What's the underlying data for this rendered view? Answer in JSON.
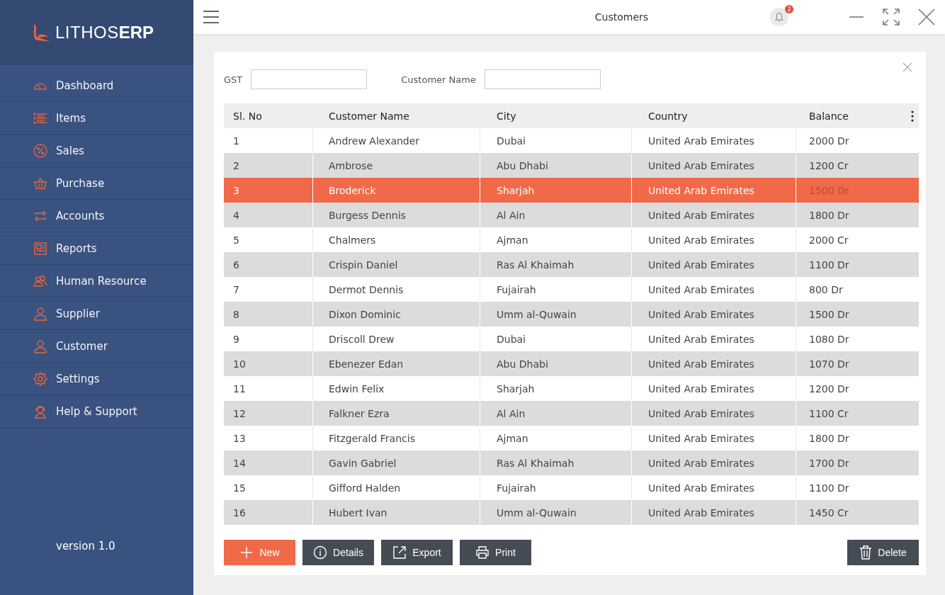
{
  "logo": {
    "light": "LITHOS",
    "bold": "ERP"
  },
  "sidebar": {
    "items": [
      {
        "label": "Dashboard",
        "kind": "gauge"
      },
      {
        "label": "Items",
        "kind": "list"
      },
      {
        "label": "Sales",
        "kind": "percent"
      },
      {
        "label": "Purchase",
        "kind": "basket"
      },
      {
        "label": "Accounts",
        "kind": "swap"
      },
      {
        "label": "Reports",
        "kind": "report"
      },
      {
        "label": "Human Resource",
        "kind": "people"
      },
      {
        "label": "Supplier",
        "kind": "person"
      },
      {
        "label": "Customer",
        "kind": "person"
      },
      {
        "label": "Settings",
        "kind": "gear"
      },
      {
        "label": "Help & Support",
        "kind": "headset"
      }
    ],
    "version": "version 1.0"
  },
  "window": {
    "title": "Customers",
    "notifications": "2"
  },
  "filters": [
    {
      "label": "GST"
    },
    {
      "label": "Customer Name"
    }
  ],
  "table": {
    "columns": [
      "Sl. No",
      "Customer Name",
      "City",
      "Country",
      "Balance"
    ],
    "rows": [
      {
        "cells": [
          "1",
          "Andrew Alexander",
          "Dubai",
          "United Arab Emirates",
          "2000 Dr"
        ],
        "selected": false
      },
      {
        "cells": [
          "2",
          "Ambrose",
          "Abu Dhabi",
          "United Arab Emirates",
          "1200 Cr"
        ],
        "selected": false
      },
      {
        "cells": [
          "3",
          "Broderick",
          "Sharjah",
          "United Arab Emirates",
          "1500 Dr"
        ],
        "selected": true
      },
      {
        "cells": [
          "4",
          "Burgess Dennis",
          "Al Ain",
          "United Arab Emirates",
          "1800 Dr"
        ],
        "selected": false
      },
      {
        "cells": [
          "5",
          "Chalmers",
          "Ajman",
          "United Arab Emirates",
          "2000 Cr"
        ],
        "selected": false
      },
      {
        "cells": [
          "6",
          "Crispin Daniel",
          "Ras Al Khaimah",
          "United Arab Emirates",
          "1100 Dr"
        ],
        "selected": false
      },
      {
        "cells": [
          "7",
          "Dermot Dennis",
          "Fujairah",
          "United Arab Emirates",
          "800 Dr"
        ],
        "selected": false
      },
      {
        "cells": [
          "8",
          "Dixon Dominic",
          "Umm al-Quwain",
          "United Arab Emirates",
          "1500 Dr"
        ],
        "selected": false
      },
      {
        "cells": [
          "9",
          "Driscoll Drew",
          "Dubai",
          "United Arab Emirates",
          "1080 Dr"
        ],
        "selected": false
      },
      {
        "cells": [
          "10",
          "Ebenezer Edan",
          "Abu Dhabi",
          "United Arab Emirates",
          "1070 Dr"
        ],
        "selected": false
      },
      {
        "cells": [
          "11",
          "Edwin Felix",
          "Sharjah",
          "United Arab Emirates",
          "1200 Dr"
        ],
        "selected": false
      },
      {
        "cells": [
          "12",
          "Falkner Ezra",
          "Al Ain",
          "United Arab Emirates",
          "1100 Cr"
        ],
        "selected": false
      },
      {
        "cells": [
          "13",
          "Fitzgerald Francis",
          "Ajman",
          "United Arab Emirates",
          "1800 Dr"
        ],
        "selected": false
      },
      {
        "cells": [
          "14",
          "Gavin Gabriel",
          "Ras Al Khaimah",
          "United Arab Emirates",
          "1700 Dr"
        ],
        "selected": false
      },
      {
        "cells": [
          "15",
          "Gifford Halden",
          "Fujairah",
          "United Arab Emirates",
          "1100 Dr"
        ],
        "selected": false
      },
      {
        "cells": [
          "16",
          "Hubert Ivan",
          "Umm al-Quwain",
          "United Arab Emirates",
          "1450 Cr"
        ],
        "selected": false
      }
    ]
  },
  "actions": [
    {
      "label": "New",
      "kind": "new"
    },
    {
      "label": "Details",
      "kind": "details"
    },
    {
      "label": "Export",
      "kind": "export"
    },
    {
      "label": "Print",
      "kind": "print"
    },
    {
      "label": "Delete",
      "kind": "delete"
    }
  ]
}
